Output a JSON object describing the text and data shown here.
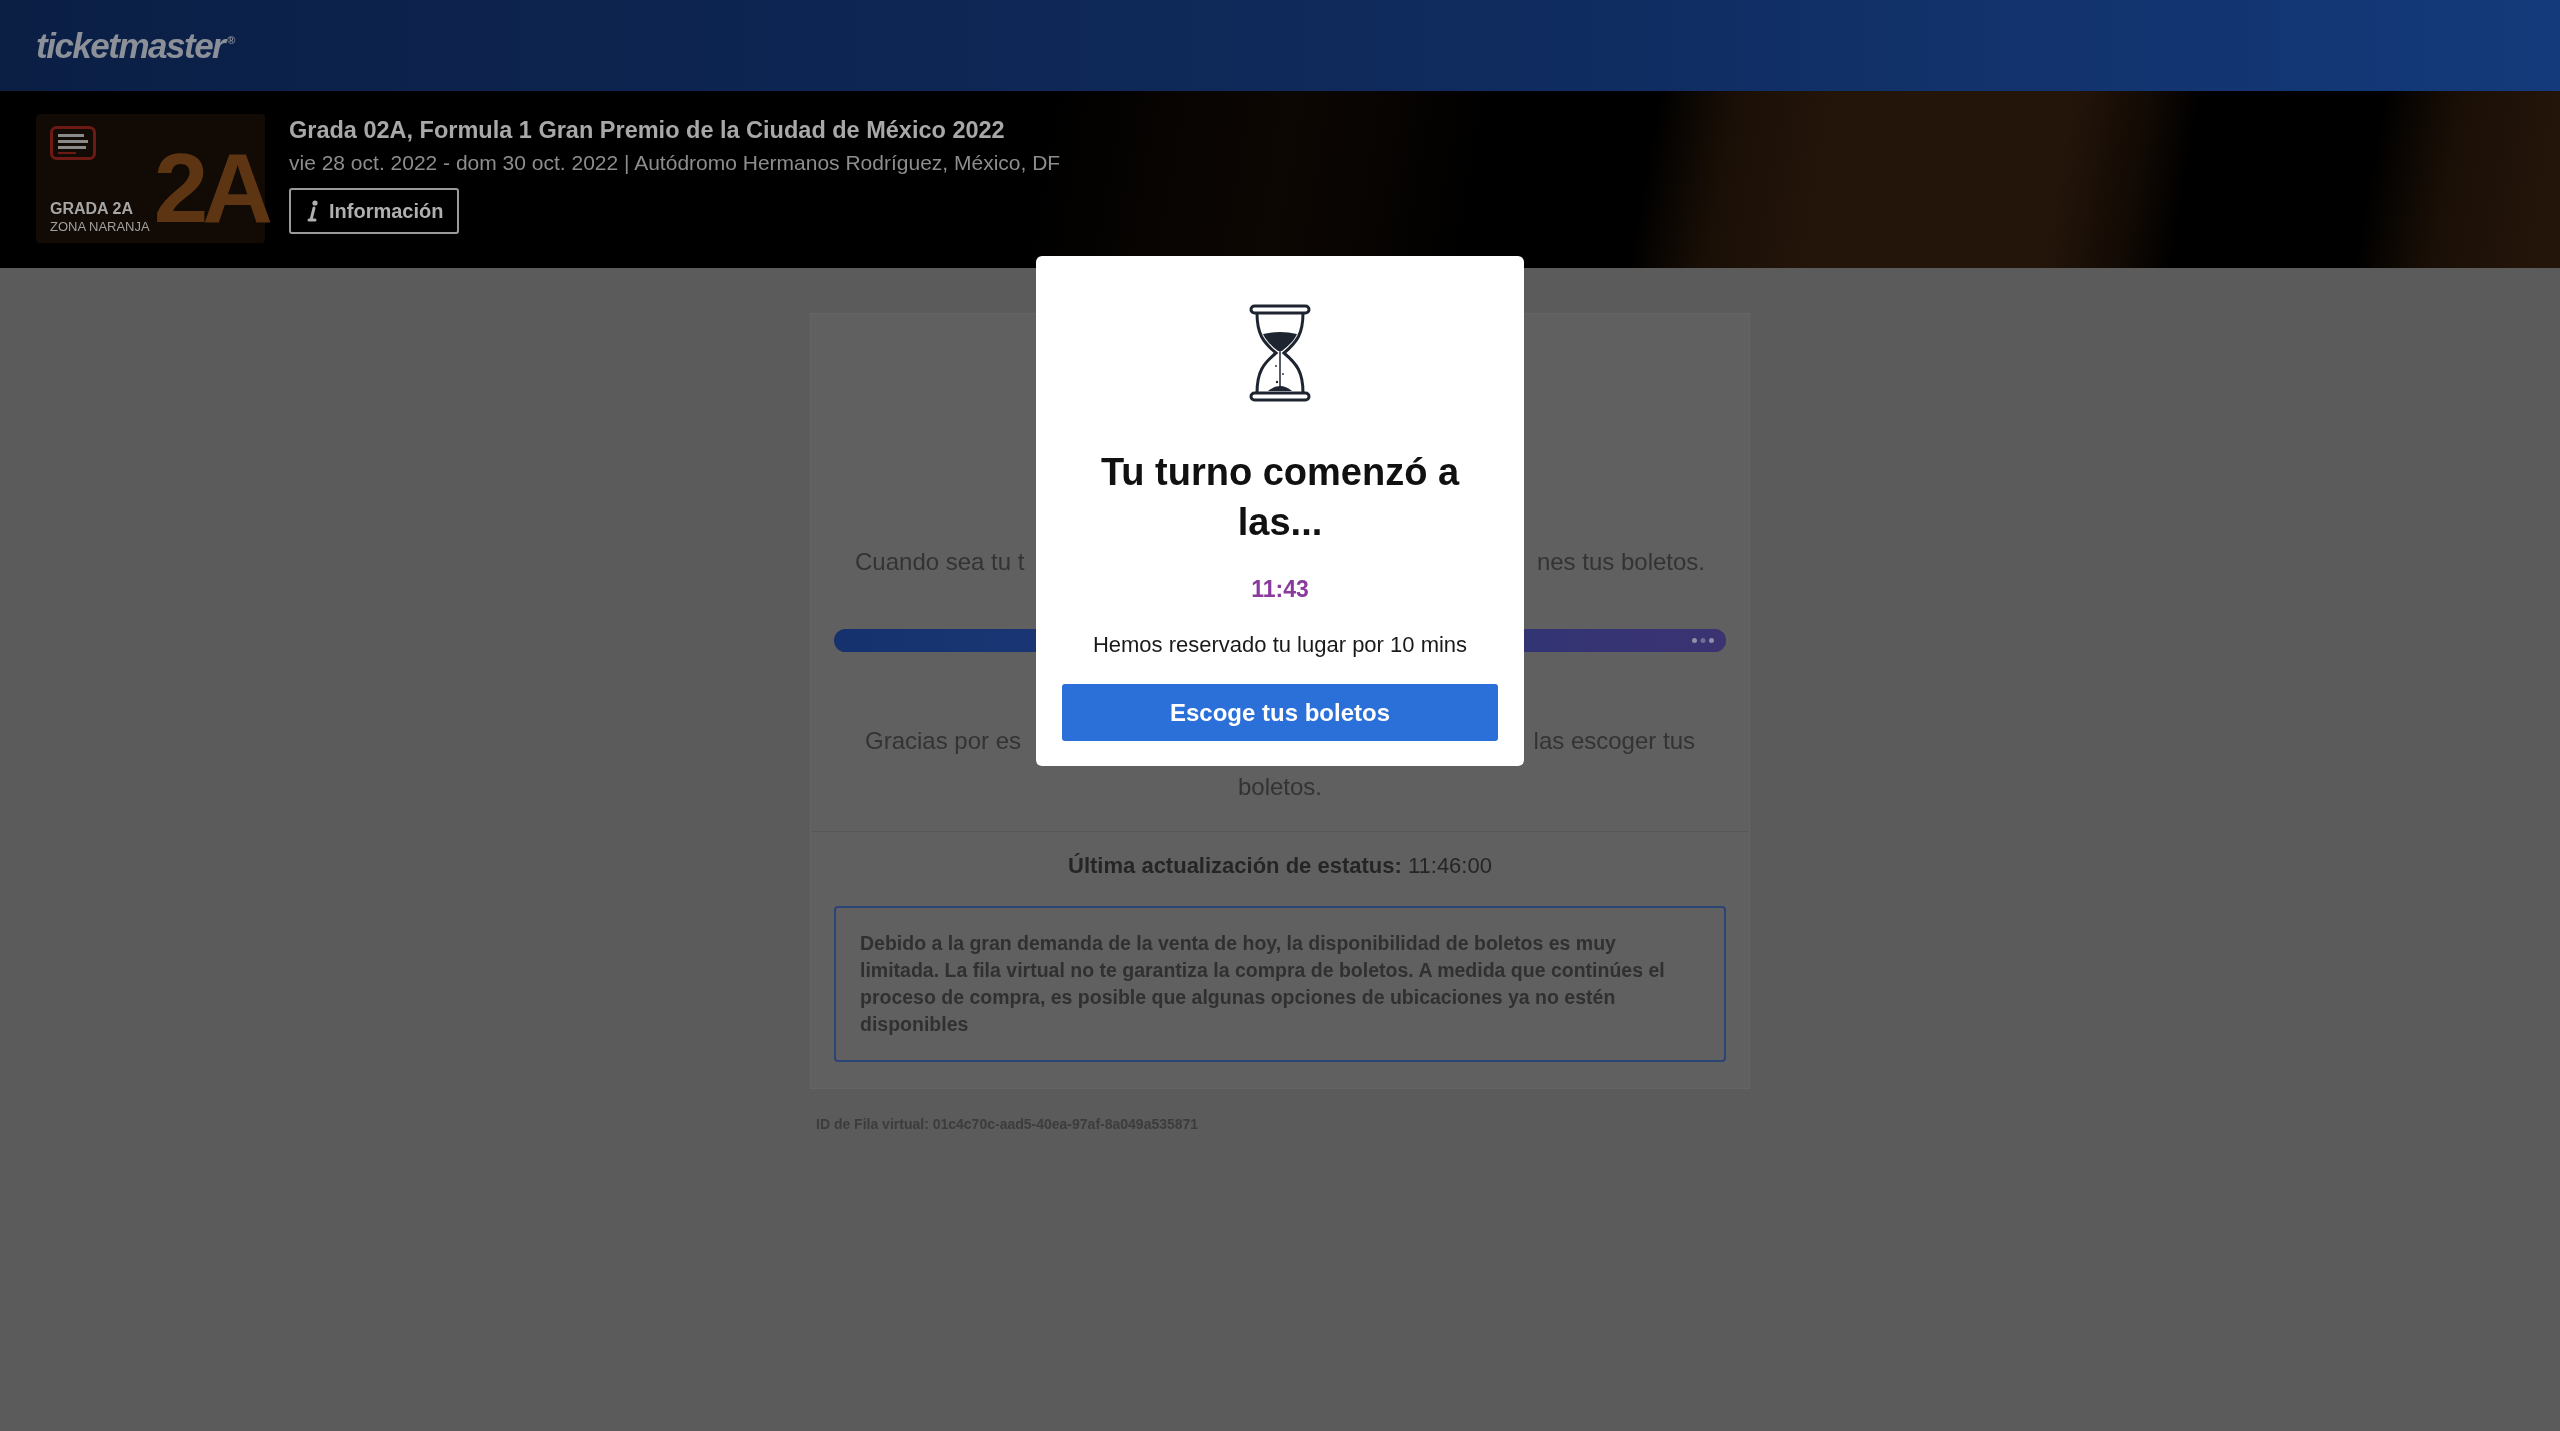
{
  "header": {
    "logo": "ticketmaster$^{®}$"
  },
  "event": {
    "thumbnail": {
      "big_text": "2A",
      "title": "GRADA 2A",
      "subtitle": "ZONA NARANJA"
    },
    "title": "Grada 02A, Formula 1 Gran Premio de la Ciudad de México 2022",
    "subtitle": "vie 28 oct. 2022 - dom 30 oct. 2022 | Autódromo Hermanos Rodríguez, México, DF",
    "info_button": "Información"
  },
  "queue_card": {
    "message_1": {
      "left": "Cuando sea tu t",
      "right": "nes tus boletos."
    },
    "progress": {
      "level": 1
    },
    "message_2": {
      "left": "Gracias por es",
      "right": "las escoger tus",
      "below": "boletos."
    },
    "status": "**Última actualización de estatus:** 11:46:00",
    "notice": "Debido a la gran demanda de la venta de hoy, la disponibilidad de boletos es muy limitada. La fila virtual no te garantiza la compra de boletos. A medida que continúes el proceso de compra, es posible que algunas opciones de ubicaciones ya no estén disponibles"
  },
  "queue_id": "ID de Fila virtual: 01c4c70c-aad5-40ea-97af-8a049a535871",
  "modal": {
    "title": "Tu turno comenzó a las...",
    "time": "11:43",
    "text": "Hemos reservado tu lugar por 10 mins",
    "button": "Escoge tus boletos"
  }
}
